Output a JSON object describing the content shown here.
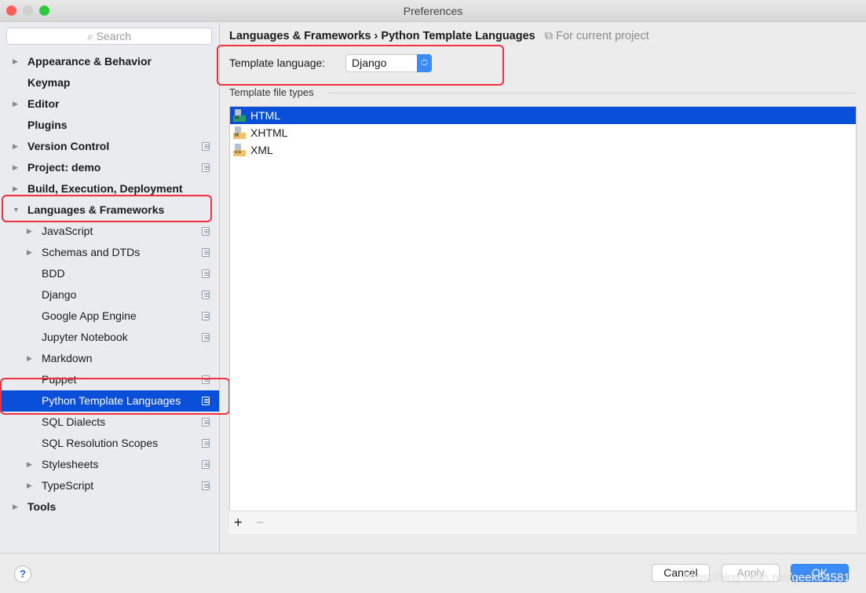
{
  "window": {
    "title": "Preferences"
  },
  "sidebar": {
    "search_placeholder": "Search",
    "items": [
      {
        "label": "Appearance & Behavior",
        "level": 0,
        "arrow": "right",
        "bold": true,
        "copy": false
      },
      {
        "label": "Keymap",
        "level": 0,
        "arrow": "",
        "bold": true,
        "copy": false
      },
      {
        "label": "Editor",
        "level": 0,
        "arrow": "right",
        "bold": true,
        "copy": false
      },
      {
        "label": "Plugins",
        "level": 0,
        "arrow": "",
        "bold": true,
        "copy": false
      },
      {
        "label": "Version Control",
        "level": 0,
        "arrow": "right",
        "bold": true,
        "copy": true
      },
      {
        "label": "Project: demo",
        "level": 0,
        "arrow": "right",
        "bold": true,
        "copy": true
      },
      {
        "label": "Build, Execution, Deployment",
        "level": 0,
        "arrow": "right",
        "bold": true,
        "copy": false
      },
      {
        "label": "Languages & Frameworks",
        "level": 0,
        "arrow": "down",
        "bold": true,
        "copy": false
      },
      {
        "label": "JavaScript",
        "level": 1,
        "arrow": "right",
        "bold": false,
        "copy": true
      },
      {
        "label": "Schemas and DTDs",
        "level": 1,
        "arrow": "right",
        "bold": false,
        "copy": true
      },
      {
        "label": "BDD",
        "level": 1,
        "arrow": "",
        "bold": false,
        "copy": true
      },
      {
        "label": "Django",
        "level": 1,
        "arrow": "",
        "bold": false,
        "copy": true
      },
      {
        "label": "Google App Engine",
        "level": 1,
        "arrow": "",
        "bold": false,
        "copy": true
      },
      {
        "label": "Jupyter Notebook",
        "level": 1,
        "arrow": "",
        "bold": false,
        "copy": true
      },
      {
        "label": "Markdown",
        "level": 1,
        "arrow": "right",
        "bold": false,
        "copy": false
      },
      {
        "label": "Puppet",
        "level": 1,
        "arrow": "",
        "bold": false,
        "copy": true
      },
      {
        "label": "Python Template Languages",
        "level": 1,
        "arrow": "",
        "bold": false,
        "copy": true,
        "selected": true
      },
      {
        "label": "SQL Dialects",
        "level": 1,
        "arrow": "",
        "bold": false,
        "copy": true
      },
      {
        "label": "SQL Resolution Scopes",
        "level": 1,
        "arrow": "",
        "bold": false,
        "copy": true
      },
      {
        "label": "Stylesheets",
        "level": 1,
        "arrow": "right",
        "bold": false,
        "copy": true
      },
      {
        "label": "TypeScript",
        "level": 1,
        "arrow": "right",
        "bold": false,
        "copy": true
      },
      {
        "label": "Tools",
        "level": 0,
        "arrow": "right",
        "bold": true,
        "copy": false
      }
    ]
  },
  "main": {
    "breadcrumb": {
      "parent": "Languages & Frameworks",
      "separator": "›",
      "current": "Python Template Languages",
      "scope": "For current project"
    },
    "template_language": {
      "label": "Template language:",
      "value": "Django"
    },
    "file_types": {
      "label": "Template file types",
      "items": [
        {
          "label": "HTML",
          "icon": "html-file-icon",
          "badge": "H",
          "color": "#2e9c6a",
          "selected": true
        },
        {
          "label": "XHTML",
          "icon": "xhtml-file-icon",
          "badge": "H",
          "color": "#f5c26b",
          "selected": false
        },
        {
          "label": "XML",
          "icon": "xml-file-icon",
          "badge": "<>",
          "color": "#f5c26b",
          "selected": false
        }
      ]
    },
    "add": "+",
    "remove": "−"
  },
  "footer": {
    "help": "?",
    "cancel": "Cancel",
    "apply": "Apply",
    "ok": "OK"
  },
  "watermark": "https://blog.csdn.net/geek64581",
  "colors": {
    "selection": "#0a4fd9",
    "highlight_box": "#f2303d",
    "ok": "#3b8cf7"
  }
}
